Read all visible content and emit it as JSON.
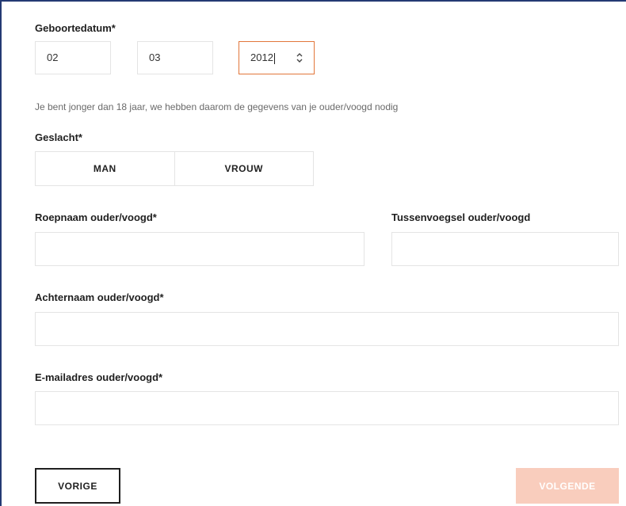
{
  "birthdate": {
    "label": "Geboortedatum*",
    "day": "02",
    "month": "03",
    "year": "2012"
  },
  "age_notice": "Je bent jonger dan 18 jaar, we hebben daarom de gegevens van je ouder/voogd nodig",
  "gender": {
    "label": "Geslacht*",
    "options": [
      "MAN",
      "VROUW"
    ]
  },
  "guardian": {
    "first_name_label": "Roepnaam ouder/voogd*",
    "first_name_value": "",
    "infix_label": "Tussenvoegsel ouder/voogd",
    "infix_value": "",
    "last_name_label": "Achternaam ouder/voogd*",
    "last_name_value": "",
    "email_label": "E-mailadres ouder/voogd*",
    "email_value": ""
  },
  "nav": {
    "prev_label": "VORIGE",
    "next_label": "VOLGENDE"
  },
  "colors": {
    "frame_border": "#243a73",
    "focus_border": "#e2763a",
    "next_button_disabled_bg": "#f9cdbd"
  }
}
